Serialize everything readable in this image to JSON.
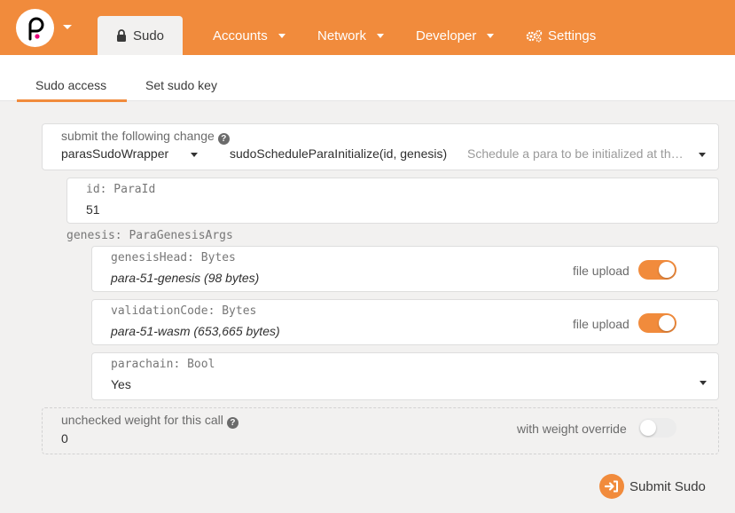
{
  "nav": {
    "logo_icon": "polkadot-logo-icon",
    "active_tab": {
      "label": "Sudo",
      "icon": "lock-icon"
    },
    "items": [
      {
        "label": "Accounts"
      },
      {
        "label": "Network"
      },
      {
        "label": "Developer"
      },
      {
        "label": "Settings",
        "icon": "gears-icon"
      }
    ],
    "accent_color": "#f18b3c"
  },
  "subtabs": [
    {
      "label": "Sudo access",
      "active": true
    },
    {
      "label": "Set sudo key",
      "active": false
    }
  ],
  "extrinsic": {
    "label": "submit the following change",
    "section": "parasSudoWrapper",
    "method": "sudoScheduleParaInitialize(id, genesis)",
    "description": "Schedule a para to be initialized at th…"
  },
  "params": {
    "id": {
      "label": "id: ParaId",
      "value": "51"
    },
    "genesis_label": "genesis: ParaGenesisArgs",
    "genesis_head": {
      "label": "genesisHead: Bytes",
      "value": "para-51-genesis (98 bytes)",
      "toggle_label": "file upload",
      "toggle_on": true
    },
    "validation_code": {
      "label": "validationCode: Bytes",
      "value": "para-51-wasm (653,665 bytes)",
      "toggle_label": "file upload",
      "toggle_on": true
    },
    "parachain": {
      "label": "parachain: Bool",
      "value": "Yes"
    }
  },
  "weight": {
    "label": "unchecked weight for this call",
    "value": "0",
    "toggle_label": "with weight override",
    "toggle_on": false
  },
  "submit": {
    "label": "Submit Sudo",
    "icon": "sign-in-icon"
  }
}
